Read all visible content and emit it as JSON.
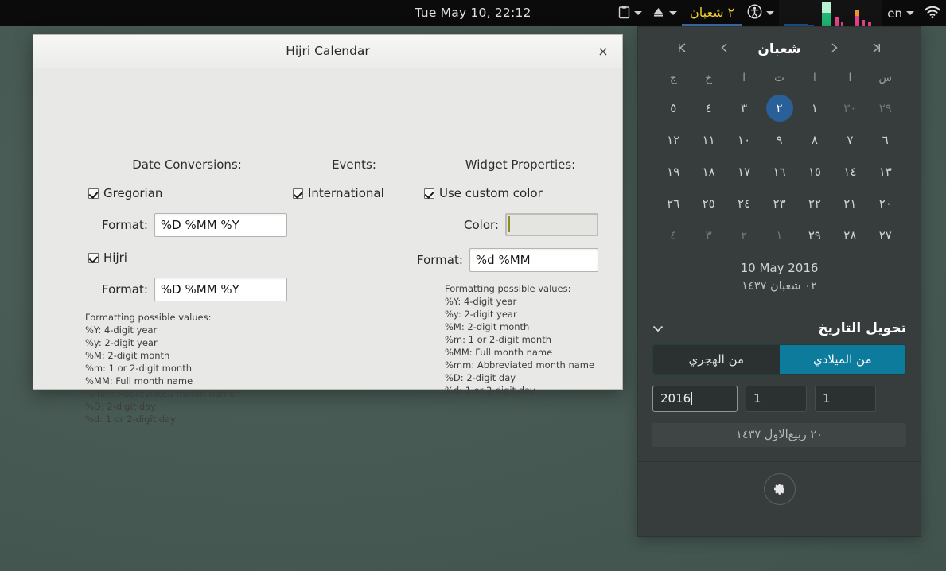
{
  "topbar": {
    "clock": "Tue May 10, 22:12",
    "clipboard_icon": "clipboard-icon",
    "eject_icon": "eject-icon",
    "hijri_indicator": "٢ شعبان",
    "accessibility_icon": "accessibility-icon",
    "language": "en",
    "network_icon": "wifi-icon"
  },
  "dialog": {
    "title": "Hijri Calendar",
    "close_label": "×",
    "columns": {
      "date_conversions": {
        "heading": "Date Conversions:",
        "gregorian_label": "Gregorian",
        "gregorian_checked": true,
        "gregorian_format_label": "Format:",
        "gregorian_format_value": "%D %MM %Y",
        "hijri_label": "Hijri",
        "hijri_checked": true,
        "hijri_format_label": "Format:",
        "hijri_format_value": "%D %MM %Y"
      },
      "events": {
        "heading": "Events:",
        "international_label": "International",
        "international_checked": true
      },
      "widget_properties": {
        "heading": "Widget Properties:",
        "use_custom_color_label": "Use custom color",
        "use_custom_color_checked": true,
        "color_label": "Color:",
        "color_value": "#e8d400",
        "format_label": "Format:",
        "format_value": "%d %MM"
      }
    },
    "format_hint": {
      "title": "Formatting possible values:",
      "lines": [
        "%Y: 4-digit year",
        "%y: 2-digit year",
        "%M: 2-digit month",
        "%m: 1 or 2-digit month",
        "%MM: Full month name",
        "%mm: Abbreviated month name",
        "%D: 2-digit day",
        "%d: 1 or 2-digit day"
      ]
    }
  },
  "widget": {
    "calendar": {
      "first_icon": "⏮",
      "prev_icon": "‹",
      "month_title": "شعبان",
      "next_icon": "›",
      "last_icon": "⏭",
      "weekdays": [
        "س",
        "ا",
        "ا",
        "ث",
        "ا",
        "خ",
        "ج"
      ],
      "weeks": [
        [
          {
            "d": "٢٩",
            "out": true
          },
          {
            "d": "٣٠",
            "out": true
          },
          {
            "d": "١",
            "out": false
          },
          {
            "d": "٢",
            "out": false,
            "selected": true
          },
          {
            "d": "٣",
            "out": false
          },
          {
            "d": "٤",
            "out": false
          },
          {
            "d": "٥",
            "out": false
          }
        ],
        [
          {
            "d": "٦",
            "out": false
          },
          {
            "d": "٧",
            "out": false
          },
          {
            "d": "٨",
            "out": false
          },
          {
            "d": "٩",
            "out": false
          },
          {
            "d": "١٠",
            "out": false
          },
          {
            "d": "١١",
            "out": false
          },
          {
            "d": "١٢",
            "out": false
          }
        ],
        [
          {
            "d": "١٣",
            "out": false
          },
          {
            "d": "١٤",
            "out": false
          },
          {
            "d": "١٥",
            "out": false
          },
          {
            "d": "١٦",
            "out": false
          },
          {
            "d": "١٧",
            "out": false
          },
          {
            "d": "١٨",
            "out": false
          },
          {
            "d": "١٩",
            "out": false
          }
        ],
        [
          {
            "d": "٢٠",
            "out": false
          },
          {
            "d": "٢١",
            "out": false
          },
          {
            "d": "٢٢",
            "out": false
          },
          {
            "d": "٢٣",
            "out": false
          },
          {
            "d": "٢٤",
            "out": false
          },
          {
            "d": "٢٥",
            "out": false
          },
          {
            "d": "٢٦",
            "out": false
          }
        ],
        [
          {
            "d": "٢٧",
            "out": false
          },
          {
            "d": "٢٨",
            "out": false
          },
          {
            "d": "٢٩",
            "out": false
          },
          {
            "d": "١",
            "out": true
          },
          {
            "d": "٢",
            "out": true
          },
          {
            "d": "٣",
            "out": true
          },
          {
            "d": "٤",
            "out": true
          }
        ]
      ],
      "footer_gregorian": "10 May 2016",
      "footer_hijri": "٠٢ شعبان ١٤٣٧"
    },
    "converter": {
      "heading": "تحويل التاريخ",
      "collapse_icon": "chevron-down-icon",
      "from_hijri_label": "من الهجري",
      "from_gregorian_label": "من الميلادي",
      "active": "from_gregorian",
      "year_value": "2016",
      "month_value": "1",
      "day_value": "1",
      "result": "٢٠ ربيع‌الاول ١٤٣٧"
    },
    "settings_icon": "gear-icon"
  }
}
